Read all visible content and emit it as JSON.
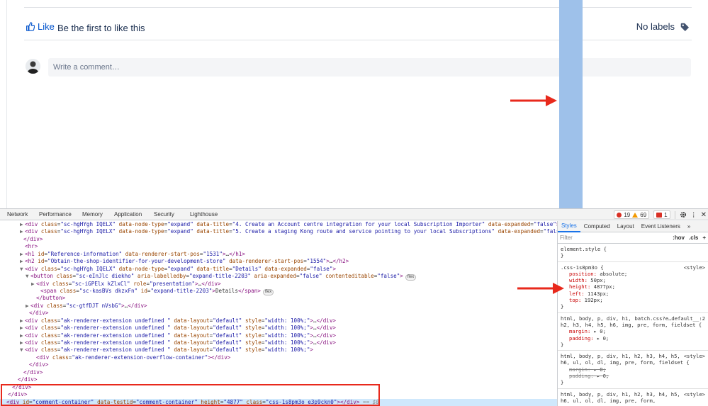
{
  "page": {
    "like_label": "Like",
    "first_like_text": "Be the first to like this",
    "labels_text": "No labels",
    "comment_placeholder": "Write a comment…"
  },
  "devtools": {
    "tabs": [
      "Network",
      "Performance",
      "Memory",
      "Application",
      "Security",
      "Lighthouse"
    ],
    "errors": "19",
    "warnings": "69",
    "issues": "1",
    "elements_lines": [
      {
        "indent": 28,
        "tri": "▶",
        "html": "<span class='tag'>&lt;div</span> <span class='an'>class</span>=<span class='av'>\"sc-hgHYgh IQELX\"</span> <span class='an'>data-node-type</span>=<span class='av'>\"expand\"</span> <span class='an'>data-title</span>=<span class='av'>\"4. Create an Account centre integration for your local Subscription Importer\"</span> <span class='an'>data-expanded</span>=<span class='av'>\"false\"</span><span class='tag'>&gt;</span>…<span class='tag'>&lt;/div&gt;</span>"
      },
      {
        "indent": 28,
        "tri": "▶",
        "html": "<span class='tag'>&lt;div</span> <span class='an'>class</span>=<span class='av'>\"sc-hgHYgh IQELX\"</span> <span class='an'>data-node-type</span>=<span class='av'>\"expand\"</span> <span class='an'>data-title</span>=<span class='av'>\"5. Create a staging Kong route and service pointing to your local Subscriptions\"</span> <span class='an'>data-expanded</span>=<span class='av'>\"false\"</span><span class='tag'>&gt;</span>…"
      },
      {
        "indent": 26,
        "tri": "",
        "html": "<span class='tag'>&lt;/div&gt;</span>"
      },
      {
        "indent": 28,
        "tri": "",
        "html": "<span class='tag'>&lt;hr&gt;</span>"
      },
      {
        "indent": 28,
        "tri": "▶",
        "html": "<span class='tag'>&lt;h1</span> <span class='an'>id</span>=<span class='av'>\"Reference-information\"</span> <span class='an'>data-renderer-start-pos</span>=<span class='av'>\"1531\"</span><span class='tag'>&gt;</span>…<span class='tag'>&lt;/h1&gt;</span>"
      },
      {
        "indent": 28,
        "tri": "▶",
        "html": "<span class='tag'>&lt;h2</span> <span class='an'>id</span>=<span class='av'>\"Obtain-the-shop-identifier-for-your-development-store\"</span> <span class='an'>data-renderer-start-pos</span>=<span class='av'>\"1554\"</span><span class='tag'>&gt;</span>…<span class='tag'>&lt;/h2&gt;</span>"
      },
      {
        "indent": 28,
        "tri": "▼",
        "html": "<span class='tag'>&lt;div</span> <span class='an'>class</span>=<span class='av'>\"sc-hgHYgh IQELX\"</span> <span class='an'>data-node-type</span>=<span class='av'>\"expand\"</span> <span class='an'>data-title</span>=<span class='av'>\"Details\"</span> <span class='an'>data-expanded</span>=<span class='av'>\"false\"</span><span class='tag'>&gt;</span>"
      },
      {
        "indent": 36,
        "tri": "▼",
        "html": "<span class='tag'>&lt;button</span> <span class='an'>class</span>=<span class='av'>\"sc-eInJlc diekho\"</span> <span class='an'>aria-labelledby</span>=<span class='av'>\"expand-title-2203\"</span> <span class='an'>aria-expanded</span>=<span class='av'>\"false\"</span> <span class='an'>contenteditable</span>=<span class='av'>\"false\"</span><span class='tag'>&gt;</span><span class='badge'>flex</span>"
      },
      {
        "indent": 44,
        "tri": "▶",
        "html": "<span class='tag'>&lt;div</span> <span class='an'>class</span>=<span class='av'>\"sc-iGPElx kZlxCl\"</span> <span class='an'>role</span>=<span class='av'>\"presentation\"</span><span class='tag'>&gt;</span>…<span class='tag'>&lt;/div&gt;</span>"
      },
      {
        "indent": 50,
        "tri": "",
        "html": "<span class='tag'>&lt;span</span> <span class='an'>class</span>=<span class='av'>\"sc-kasBVs dkzxFn\"</span> <span class='an'>id</span>=<span class='av'>\"expand-title-2203\"</span><span class='tag'>&gt;</span><span class='txt'>Details</span><span class='tag'>&lt;/span&gt;</span><span class='badge'>flex</span>"
      },
      {
        "indent": 44,
        "tri": "",
        "html": "<span class='tag'>&lt;/button&gt;</span>"
      },
      {
        "indent": 36,
        "tri": "▶",
        "html": "<span class='tag'>&lt;div</span> <span class='an'>class</span>=<span class='av'>\"sc-gtfDJT nVsbG\"</span><span class='tag'>&gt;</span>…<span class='tag'>&lt;/div&gt;</span>"
      },
      {
        "indent": 34,
        "tri": "",
        "html": "<span class='tag'>&lt;/div&gt;</span>"
      },
      {
        "indent": 28,
        "tri": "▶",
        "html": "<span class='tag'>&lt;div</span> <span class='an'>class</span>=<span class='av'>\"ak-renderer-extension undefined \"</span> <span class='an'>data-layout</span>=<span class='av'>\"default\"</span> <span class='an'>style</span>=<span class='av'>\"width: 100%;\"</span><span class='tag'>&gt;</span>…<span class='tag'>&lt;/div&gt;</span>"
      },
      {
        "indent": 28,
        "tri": "▶",
        "html": "<span class='tag'>&lt;div</span> <span class='an'>class</span>=<span class='av'>\"ak-renderer-extension undefined \"</span> <span class='an'>data-layout</span>=<span class='av'>\"default\"</span> <span class='an'>style</span>=<span class='av'>\"width: 100%;\"</span><span class='tag'>&gt;</span>…<span class='tag'>&lt;/div&gt;</span>"
      },
      {
        "indent": 28,
        "tri": "▶",
        "html": "<span class='tag'>&lt;div</span> <span class='an'>class</span>=<span class='av'>\"ak-renderer-extension undefined \"</span> <span class='an'>data-layout</span>=<span class='av'>\"default\"</span> <span class='an'>style</span>=<span class='av'>\"width: 100%;\"</span><span class='tag'>&gt;</span>…<span class='tag'>&lt;/div&gt;</span>"
      },
      {
        "indent": 28,
        "tri": "▶",
        "html": "<span class='tag'>&lt;div</span> <span class='an'>class</span>=<span class='av'>\"ak-renderer-extension undefined \"</span> <span class='an'>data-layout</span>=<span class='av'>\"default\"</span> <span class='an'>style</span>=<span class='av'>\"width: 100%;\"</span><span class='tag'>&gt;</span>…<span class='tag'>&lt;/div&gt;</span>"
      },
      {
        "indent": 28,
        "tri": "▼",
        "html": "<span class='tag'>&lt;div</span> <span class='an'>class</span>=<span class='av'>\"ak-renderer-extension undefined \"</span> <span class='an'>data-layout</span>=<span class='av'>\"default\"</span> <span class='an'>style</span>=<span class='av'>\"width: 100%;\"</span><span class='tag'>&gt;</span>"
      },
      {
        "indent": 44,
        "tri": "",
        "html": "<span class='tag'>&lt;div</span> <span class='an'>class</span>=<span class='av'>\"ak-renderer-extension-overflow-container\"</span><span class='tag'>&gt;&lt;/div&gt;</span>"
      },
      {
        "indent": 34,
        "tri": "",
        "html": "<span class='tag'>&lt;/div&gt;</span>"
      },
      {
        "indent": 26,
        "tri": "",
        "html": "<span class='tag'>&lt;/div&gt;</span>"
      },
      {
        "indent": 18,
        "tri": "",
        "html": "<span class='tag'>&lt;/div&gt;</span>"
      },
      {
        "indent": 10,
        "tri": "",
        "html": "<span class='tag'>&lt;/div&gt;</span>"
      },
      {
        "indent": 4,
        "tri": "",
        "html": "<span class='tag'>&lt;/div&gt;</span>"
      },
      {
        "indent": 2,
        "tri": "",
        "html": "<span class='tag'>&lt;div</span> <span class='an'>id</span>=<span class='av'>\"comment-container\"</span> <span class='an'>data-testid</span>=<span class='av'>\"comment-container\"</span> <span class='an'>height</span>=<span class='av'>\"4877\"</span> <span class='an'>class</span>=<span class='av'>\"css-1s8pm3o e3p9ckn0\"</span><span class='tag'>&gt;&lt;/div&gt;</span> <span class='sel-eq'>== $0</span>",
        "selected": true
      }
    ],
    "styles_tabs": [
      "Styles",
      "Computed",
      "Layout",
      "Event Listeners"
    ],
    "filter_placeholder": "Filter",
    "filter_buttons": [
      ":hov",
      ".cls",
      "+"
    ],
    "rules": [
      {
        "selector": "element.style {",
        "source": "",
        "props": [],
        "close": "}"
      },
      {
        "selector": ".css-1s8pm3o {",
        "source": "<style>",
        "props": [
          {
            "name": "position",
            "value": "absolute;"
          },
          {
            "name": "width",
            "value": "50px;"
          },
          {
            "name": "height",
            "value": "4877px;"
          },
          {
            "name": "left",
            "value": "1143px;"
          },
          {
            "name": "top",
            "value": "192px;"
          }
        ],
        "close": "}"
      },
      {
        "selector": "html, body, p, div, h1, h2, h3, h4, h5, h6, img, pre, form, fieldset {",
        "source": "batch.css?e…default__:2",
        "props": [
          {
            "name": "margin",
            "value": "▸ 0;"
          },
          {
            "name": "padding",
            "value": "▸ 0;"
          }
        ],
        "close": "}"
      },
      {
        "selector": "html, body, p, div, h1, h2, h3, h4, h5, h6, ul, ol, dl, img, pre, form, fieldset {",
        "source": "<style>",
        "props": [
          {
            "name": "margin",
            "value": "▸ 0;",
            "strike": true
          },
          {
            "name": "padding",
            "value": "▸ 0;",
            "strike": true
          }
        ],
        "close": "}"
      },
      {
        "selector": "html, body, p, div, h1, h2, h3, h4, h5, h6, ul, ol, dl, img, pre, form,",
        "source": "<style>",
        "props": [],
        "close": ""
      }
    ]
  },
  "colors": {
    "link": "#0052cc",
    "annotation_red": "#e8291c",
    "highlight_blue": "#9ec1ea",
    "selected_row": "#cfe8fc"
  }
}
